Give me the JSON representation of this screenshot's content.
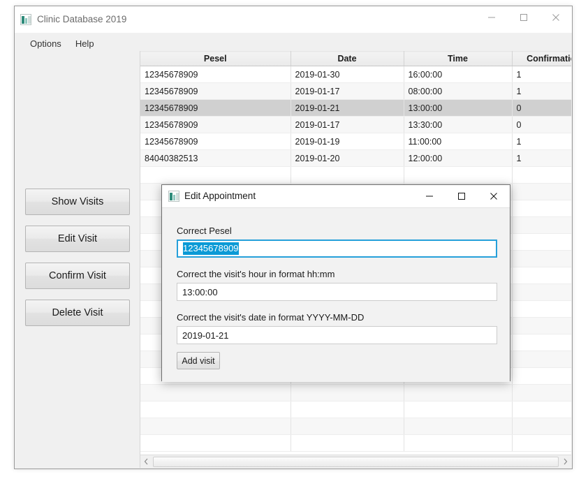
{
  "main_window": {
    "title": "Clinic Database 2019",
    "icon": "app-window-icon",
    "controls": {
      "minimize": "minimize-icon",
      "maximize": "maximize-icon",
      "close": "close-icon"
    },
    "menubar": [
      {
        "label": "Options"
      },
      {
        "label": "Help"
      }
    ]
  },
  "sidebar": {
    "buttons": [
      {
        "label": "Show Visits"
      },
      {
        "label": "Edit Visit"
      },
      {
        "label": "Confirm Visit"
      },
      {
        "label": "Delete Visit"
      }
    ]
  },
  "table": {
    "columns": [
      "Pesel",
      "Date",
      "Time",
      "Confirmation"
    ],
    "rows": [
      {
        "pesel": "12345678909",
        "date": "2019-01-30",
        "time": "16:00:00",
        "confirmation": "1",
        "selected": false
      },
      {
        "pesel": "12345678909",
        "date": "2019-01-17",
        "time": "08:00:00",
        "confirmation": "1",
        "selected": false
      },
      {
        "pesel": "12345678909",
        "date": "2019-01-21",
        "time": "13:00:00",
        "confirmation": "0",
        "selected": true
      },
      {
        "pesel": "12345678909",
        "date": "2019-01-17",
        "time": "13:30:00",
        "confirmation": "0",
        "selected": false
      },
      {
        "pesel": "12345678909",
        "date": "2019-01-19",
        "time": "11:00:00",
        "confirmation": "1",
        "selected": false
      },
      {
        "pesel": "84040382513",
        "date": "2019-01-20",
        "time": "12:00:00",
        "confirmation": "1",
        "selected": false
      },
      {
        "pesel": "",
        "date": "",
        "time": "",
        "confirmation": "",
        "selected": false
      },
      {
        "pesel": "",
        "date": "",
        "time": "",
        "confirmation": "",
        "selected": false
      },
      {
        "pesel": "",
        "date": "",
        "time": "",
        "confirmation": "",
        "selected": false
      },
      {
        "pesel": "",
        "date": "",
        "time": "",
        "confirmation": "",
        "selected": false
      },
      {
        "pesel": "",
        "date": "",
        "time": "",
        "confirmation": "",
        "selected": false
      },
      {
        "pesel": "",
        "date": "",
        "time": "",
        "confirmation": "",
        "selected": false
      },
      {
        "pesel": "",
        "date": "",
        "time": "",
        "confirmation": "",
        "selected": false
      },
      {
        "pesel": "",
        "date": "",
        "time": "",
        "confirmation": "",
        "selected": false
      },
      {
        "pesel": "",
        "date": "",
        "time": "",
        "confirmation": "",
        "selected": false
      },
      {
        "pesel": "",
        "date": "",
        "time": "",
        "confirmation": "",
        "selected": false
      },
      {
        "pesel": "",
        "date": "",
        "time": "",
        "confirmation": "",
        "selected": false
      },
      {
        "pesel": "",
        "date": "",
        "time": "",
        "confirmation": "",
        "selected": false
      },
      {
        "pesel": "",
        "date": "",
        "time": "",
        "confirmation": "",
        "selected": false
      },
      {
        "pesel": "",
        "date": "",
        "time": "",
        "confirmation": "",
        "selected": false
      },
      {
        "pesel": "",
        "date": "",
        "time": "",
        "confirmation": "",
        "selected": false
      },
      {
        "pesel": "",
        "date": "",
        "time": "",
        "confirmation": "",
        "selected": false
      },
      {
        "pesel": "",
        "date": "",
        "time": "",
        "confirmation": "",
        "selected": false
      }
    ],
    "scrollbar": {
      "left_arrow": "chevron-left-icon",
      "right_arrow": "chevron-right-icon"
    }
  },
  "dialog": {
    "title": "Edit Appointment",
    "icon": "app-window-icon",
    "controls": {
      "minimize": "minimize-icon",
      "maximize": "maximize-icon",
      "close": "close-icon"
    },
    "fields": [
      {
        "label": "Correct Pesel",
        "value": "12345678909"
      },
      {
        "label": "Correct the visit's hour in format hh:mm",
        "value": "13:00:00"
      },
      {
        "label": "Correct the visit's date in format YYYY-MM-DD",
        "value": "2019-01-21"
      }
    ],
    "submit_label": "Add visit"
  },
  "colors": {
    "selection_highlight": "#0b9ad6",
    "focus_border": "#26a0da",
    "row_selected": "#d0d0d0",
    "window_chrome": "#f0f0f0"
  }
}
